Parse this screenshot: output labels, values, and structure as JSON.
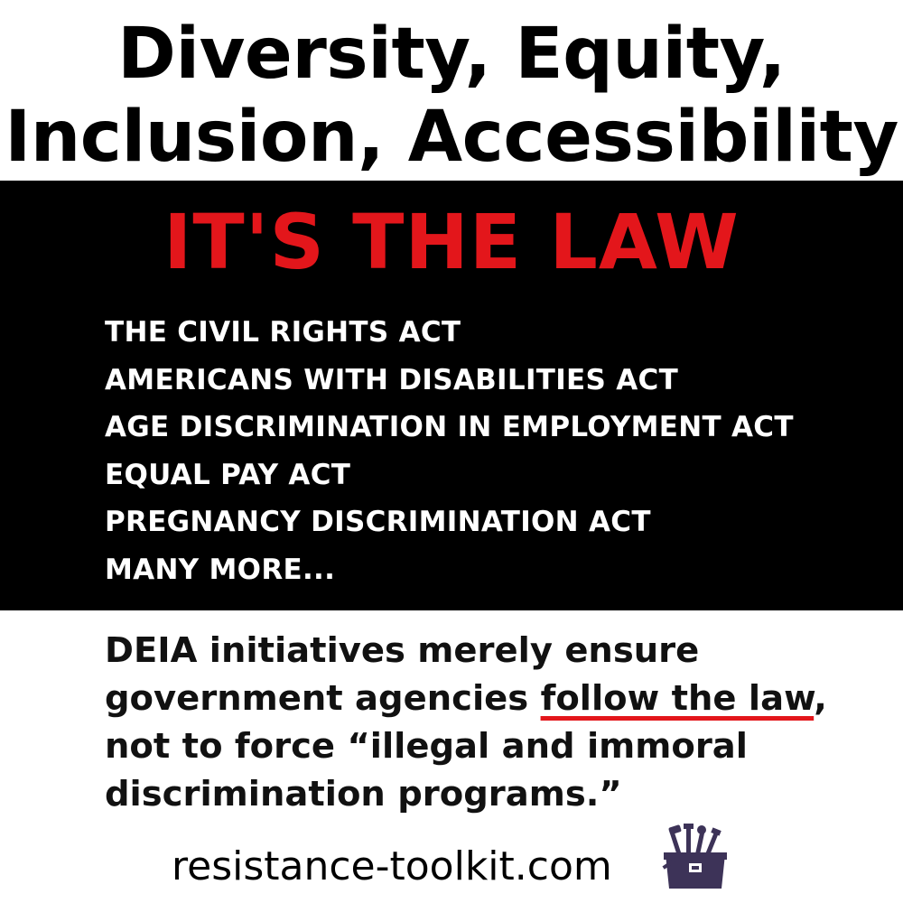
{
  "title": {
    "line1": "Diversity, Equity,",
    "line2": "Inclusion, Accessibility"
  },
  "headline": "IT'S THE LAW",
  "laws": [
    "THE CIVIL RIGHTS ACT",
    "AMERICANS WITH DISABILITIES ACT",
    "AGE DISCRIMINATION IN EMPLOYMENT ACT",
    "EQUAL PAY ACT",
    "PREGNANCY DISCRIMINATION ACT",
    "MANY MORE..."
  ],
  "body": {
    "line1": "DEIA initiatives merely ensure",
    "line2_prefix": "government agencies ",
    "line2_emphasis": "follow the law",
    "line2_suffix": ",",
    "line3": "not to force “illegal and immoral",
    "line4": "discrimination programs.”"
  },
  "footer": {
    "site": "resistance-toolkit.com",
    "logo_icon": "toolbox-icon"
  },
  "colors": {
    "background": "#ffffff",
    "band": "#000000",
    "accent_red": "#e3161b",
    "law_text": "#ffffff",
    "body_text": "#111111",
    "logo_purple": "#3d3358"
  }
}
